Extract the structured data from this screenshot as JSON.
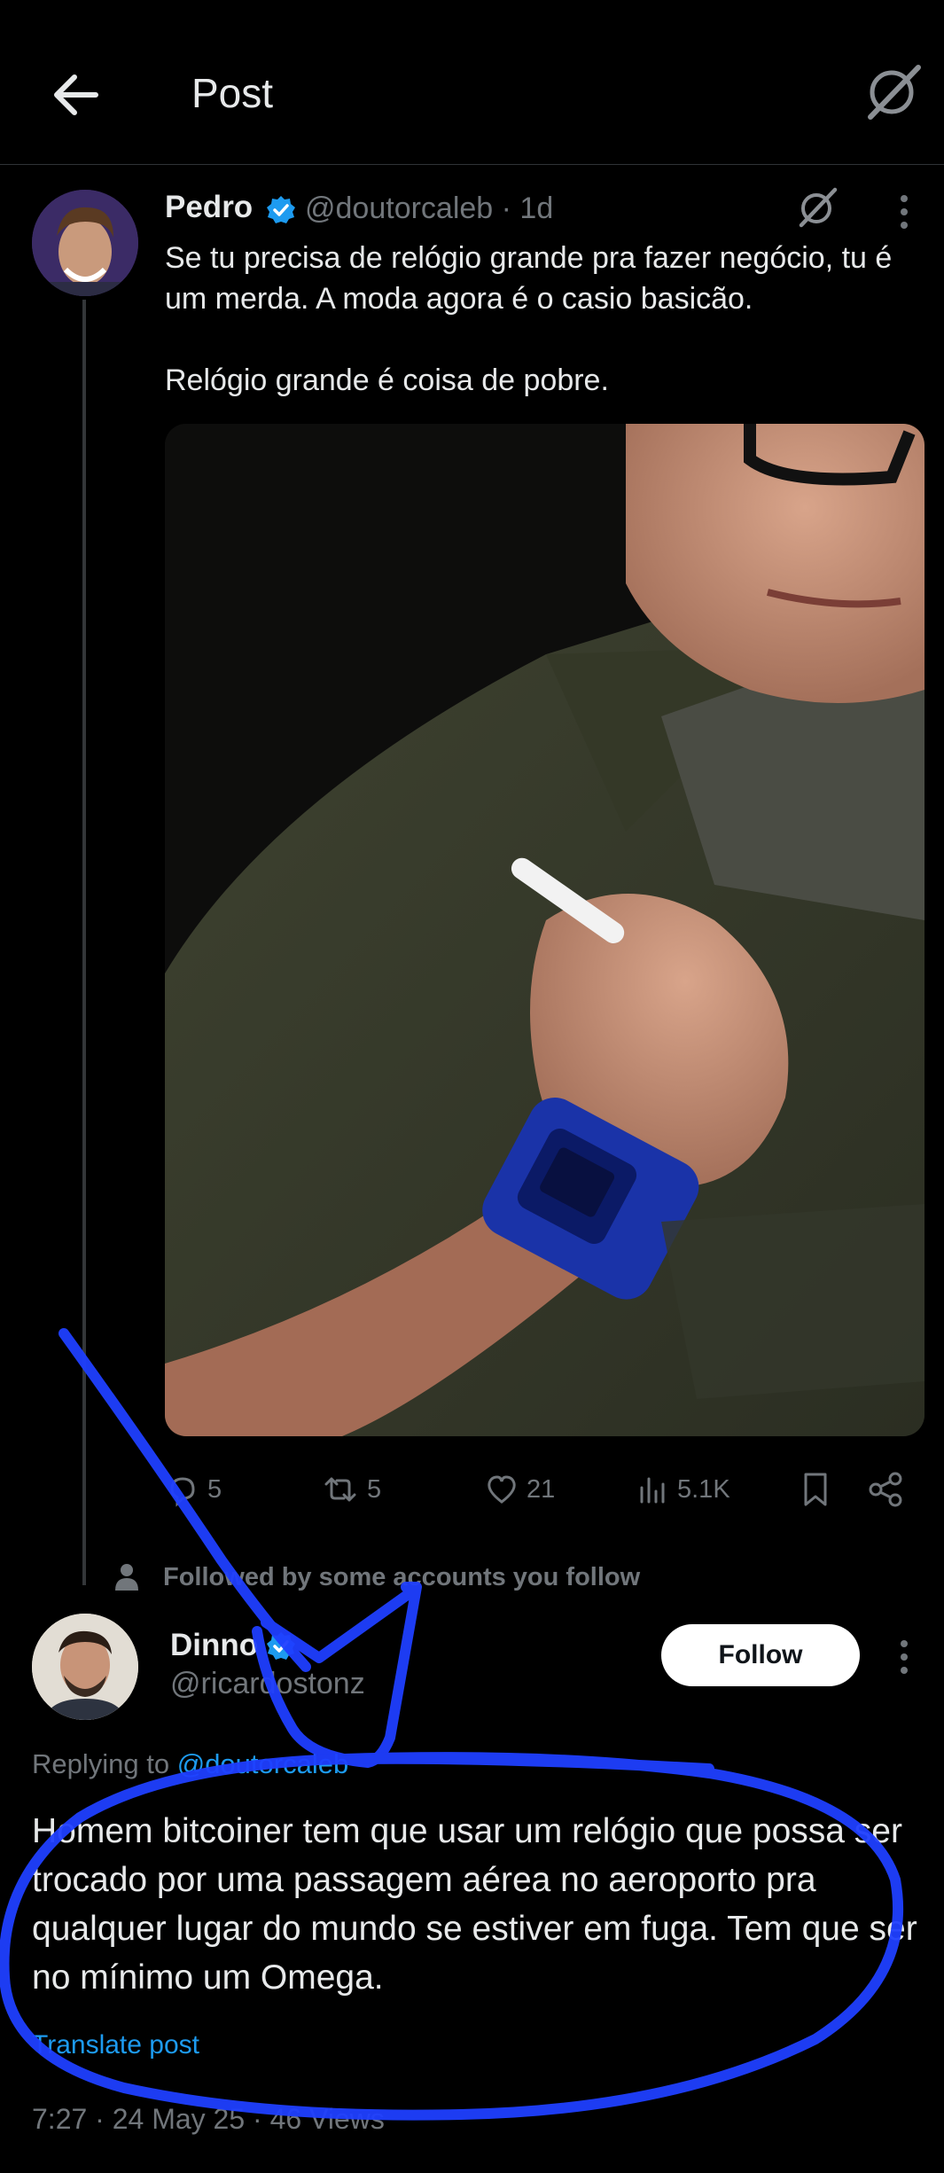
{
  "header": {
    "title": "Post",
    "back_icon": "arrow-left-icon",
    "grok_icon": "grok-icon"
  },
  "tweet": {
    "author_name": "Pedro",
    "handle_time": "@doutorcaleb · 1d",
    "text_line1": "Se tu precisa de relógio grande pra fazer negócio, tu é um merda. A moda agora é o casio basicão.",
    "text_line2": "Relógio grande é coisa de pobre.",
    "media_description": "photo-man-blue-casio-watch",
    "stats": {
      "replies": "5",
      "reposts": "5",
      "likes": "21",
      "views": "5.1K"
    }
  },
  "followed_by": "Followed by some accounts you follow",
  "reply": {
    "author_name": "Dinno",
    "handle": "@ricardostonz",
    "follow_label": "Follow",
    "replying_prefix": "Replying to ",
    "replying_to": "@doutorcaleb",
    "text": "Homem bitcoiner tem que usar um relógio que possa ser trocado por uma passagem aérea no aeroporto pra qualquer lugar do mundo se estiver em fuga. Tem que ser no mínimo um Omega.",
    "translate_label": "Translate post",
    "meta": "7:27 · 24 May 25 · 46 Views"
  },
  "colors": {
    "background": "#000000",
    "text": "#e7e9ea",
    "muted": "#71767b",
    "link": "#1d9bf0",
    "verified": "#1d9bf0",
    "annotation_ink": "#1f3fff"
  }
}
